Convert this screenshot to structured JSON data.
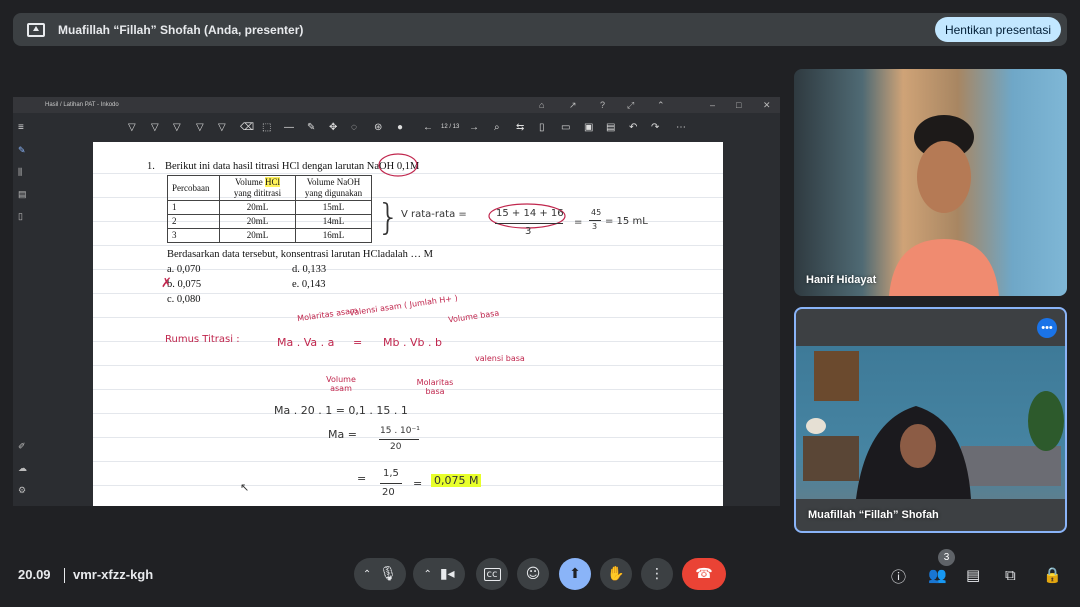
{
  "top_bar": {
    "presenter_title": "Muafillah “Fillah” Shofah (Anda, presenter)",
    "stop_button": "Hentikan presentasi"
  },
  "shared_window": {
    "title": "Hasil / Latihan PAT - Inkodo",
    "page_indicator": "12 / 13"
  },
  "question": {
    "number": "1.",
    "stem": "Berikut ini data hasil titrasi HCl dengan larutan NaOH 0,1M",
    "table": {
      "headers": [
        [
          "Percobaan"
        ],
        [
          "Volume ",
          "HCl",
          "yang dititrasi"
        ],
        [
          "Volume NaOH",
          "yang digunakan"
        ]
      ],
      "rows": [
        [
          "1",
          "20mL",
          "15mL"
        ],
        [
          "2",
          "20mL",
          "14mL"
        ],
        [
          "3",
          "20mL",
          "16mL"
        ]
      ]
    },
    "prompt": "Berdasarkan data tersebut, konsentrasi larutan HCladalah … M",
    "options": [
      {
        "letter": "a.",
        "value": "0,070"
      },
      {
        "letter": "b.",
        "value": "0,075"
      },
      {
        "letter": "c.",
        "value": "0,080"
      },
      {
        "letter": "d.",
        "value": "0,133"
      },
      {
        "letter": "e.",
        "value": "0,143"
      }
    ]
  },
  "handwriting": {
    "v_label": "V rata-rata =",
    "v_frac_num": "15 + 14 + 16",
    "v_frac_den": "3",
    "v_result_eq": "=",
    "v_result_num": "45",
    "v_result_den": "3",
    "v_result_tail": "= 15 mL",
    "rumus": "Rumus Titrasi :",
    "formula_left": "Ma . Va . a",
    "formula_eq": "=",
    "formula_right": "Mb . Vb . b",
    "ann_molaritas_asam": "Molaritas asam",
    "ann_valensi_asam": "valensi asam ( Jumlah H+ )",
    "ann_volume_basa": "Volume basa",
    "ann_valensi_basa": "valensi basa",
    "ann_volume_asam": "Volume asam",
    "ann_molaritas_basa": "Molaritas basa",
    "step1": "Ma . 20 . 1   =   0,1 . 15 . 1",
    "step2_left": "Ma   =",
    "step2_num": "15 . 10⁻¹",
    "step2_den": "20",
    "step3_eq": "=",
    "step3_num": "1,5",
    "step3_den": "20",
    "step3_eq2": "=",
    "answer": "0,075 M"
  },
  "participants": [
    {
      "name": "Hanif Hidayat"
    },
    {
      "name": "Muafillah “Fillah” Shofah"
    }
  ],
  "bottom_bar": {
    "time": "20.09",
    "meeting_code": "vmr-xfzz-kgh",
    "participant_count": "3"
  },
  "colors": {
    "present_button": "#8ab4f8",
    "leave_button": "#ea4335",
    "stop_button_bg": "#c2e7ff",
    "ink_red": "#c0264d",
    "highlight": "#e8ff2a"
  }
}
